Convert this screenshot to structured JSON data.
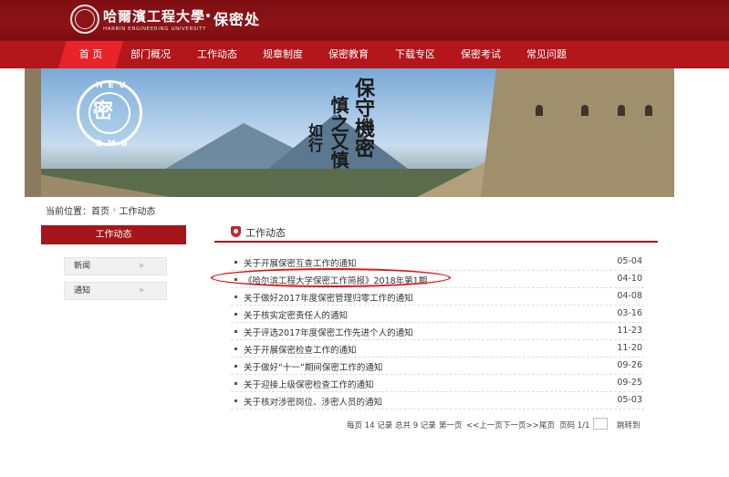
{
  "header": {
    "univ_cn": "哈爾濱工程大學",
    "univ_en": "HARBIN ENGINEERING UNIVERSITY",
    "dept": "保密处"
  },
  "nav": {
    "items": [
      "首 页",
      "部门概况",
      "工作动态",
      "规章制度",
      "保密教育",
      "下载专区",
      "保密考试",
      "常见问题"
    ],
    "active_index": 0
  },
  "banner": {
    "emblem_top": "HEU",
    "emblem_bottom": "BMB",
    "emblem_glyph": "密",
    "calligraphy": [
      "保守機密",
      "慎之又慎",
      "如行"
    ]
  },
  "breadcrumb": {
    "prefix": "当前位置：",
    "home": "首页",
    "sep": "›",
    "current": "工作动态"
  },
  "sidebar": {
    "heading": "工作动态",
    "items": [
      {
        "label": "新闻",
        "chevron": "»"
      },
      {
        "label": "通知",
        "chevron": "»"
      }
    ]
  },
  "main": {
    "section_title": "工作动态",
    "news": [
      {
        "title": "关于开展保密互查工作的通知",
        "date": "05-04"
      },
      {
        "title": "《哈尔滨工程大学保密工作简报》2018年第1期",
        "date": "04-10"
      },
      {
        "title": "关于做好2017年度保密管理归零工作的通知",
        "date": "04-08"
      },
      {
        "title": "关于核实定密责任人的通知",
        "date": "03-16"
      },
      {
        "title": "关于评选2017年度保密工作先进个人的通知",
        "date": "11-23"
      },
      {
        "title": "关于开展保密检查工作的通知",
        "date": "11-20"
      },
      {
        "title": "关于做好“十一”期间保密工作的通知",
        "date": "09-26"
      },
      {
        "title": "关于迎接上级保密检查工作的通知",
        "date": "09-25"
      },
      {
        "title": "关于核对涉密岗位、涉密人员的通知",
        "date": "05-03"
      }
    ],
    "highlighted_index": 1
  },
  "pager": {
    "per_page": "每页 14 记录",
    "total": "总共 9 记录",
    "first": "第一页",
    "prev": "<<上一页",
    "next": "下一页>>",
    "last": "尾页",
    "page_info": "页码 1/1",
    "goto": "跳转到"
  },
  "colors": {
    "header_red": "#8c1317",
    "nav_red": "#b3161b",
    "active_red": "#e8242a",
    "accent": "#a5151a",
    "highlight": "#e0141c"
  }
}
